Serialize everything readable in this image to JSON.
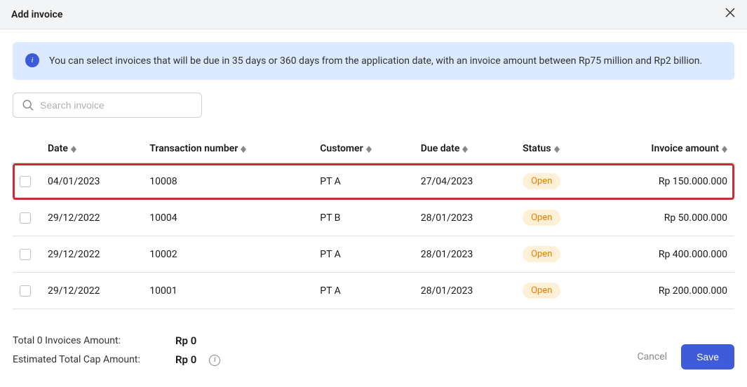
{
  "header": {
    "title": "Add invoice"
  },
  "banner": {
    "text": "You can select invoices that will be due in 35 days or 360 days from the application date, with an invoice amount between Rp75 million and Rp2 billion."
  },
  "search": {
    "placeholder": "Search invoice"
  },
  "columns": {
    "date": "Date",
    "txn": "Transaction number",
    "customer": "Customer",
    "due": "Due date",
    "status": "Status",
    "amount": "Invoice amount"
  },
  "rows": [
    {
      "date": "04/01/2023",
      "txn": "10008",
      "customer": "PT A",
      "due": "27/04/2023",
      "status": "Open",
      "amount": "Rp 150.000.000",
      "highlight": true
    },
    {
      "date": "29/12/2022",
      "txn": "10004",
      "customer": "PT B",
      "due": "28/01/2023",
      "status": "Open",
      "amount": "Rp 50.000.000",
      "highlight": false
    },
    {
      "date": "29/12/2022",
      "txn": "10002",
      "customer": "PT A",
      "due": "28/01/2023",
      "status": "Open",
      "amount": "Rp 400.000.000",
      "highlight": false
    },
    {
      "date": "29/12/2022",
      "txn": "10001",
      "customer": "PT A",
      "due": "28/01/2023",
      "status": "Open",
      "amount": "Rp 200.000.000",
      "highlight": false
    }
  ],
  "footer": {
    "total_label": "Total 0 Invoices Amount:",
    "total_value": "Rp 0",
    "cap_label": "Estimated Total Cap Amount:",
    "cap_value": "Rp 0",
    "cancel": "Cancel",
    "save": "Save"
  }
}
